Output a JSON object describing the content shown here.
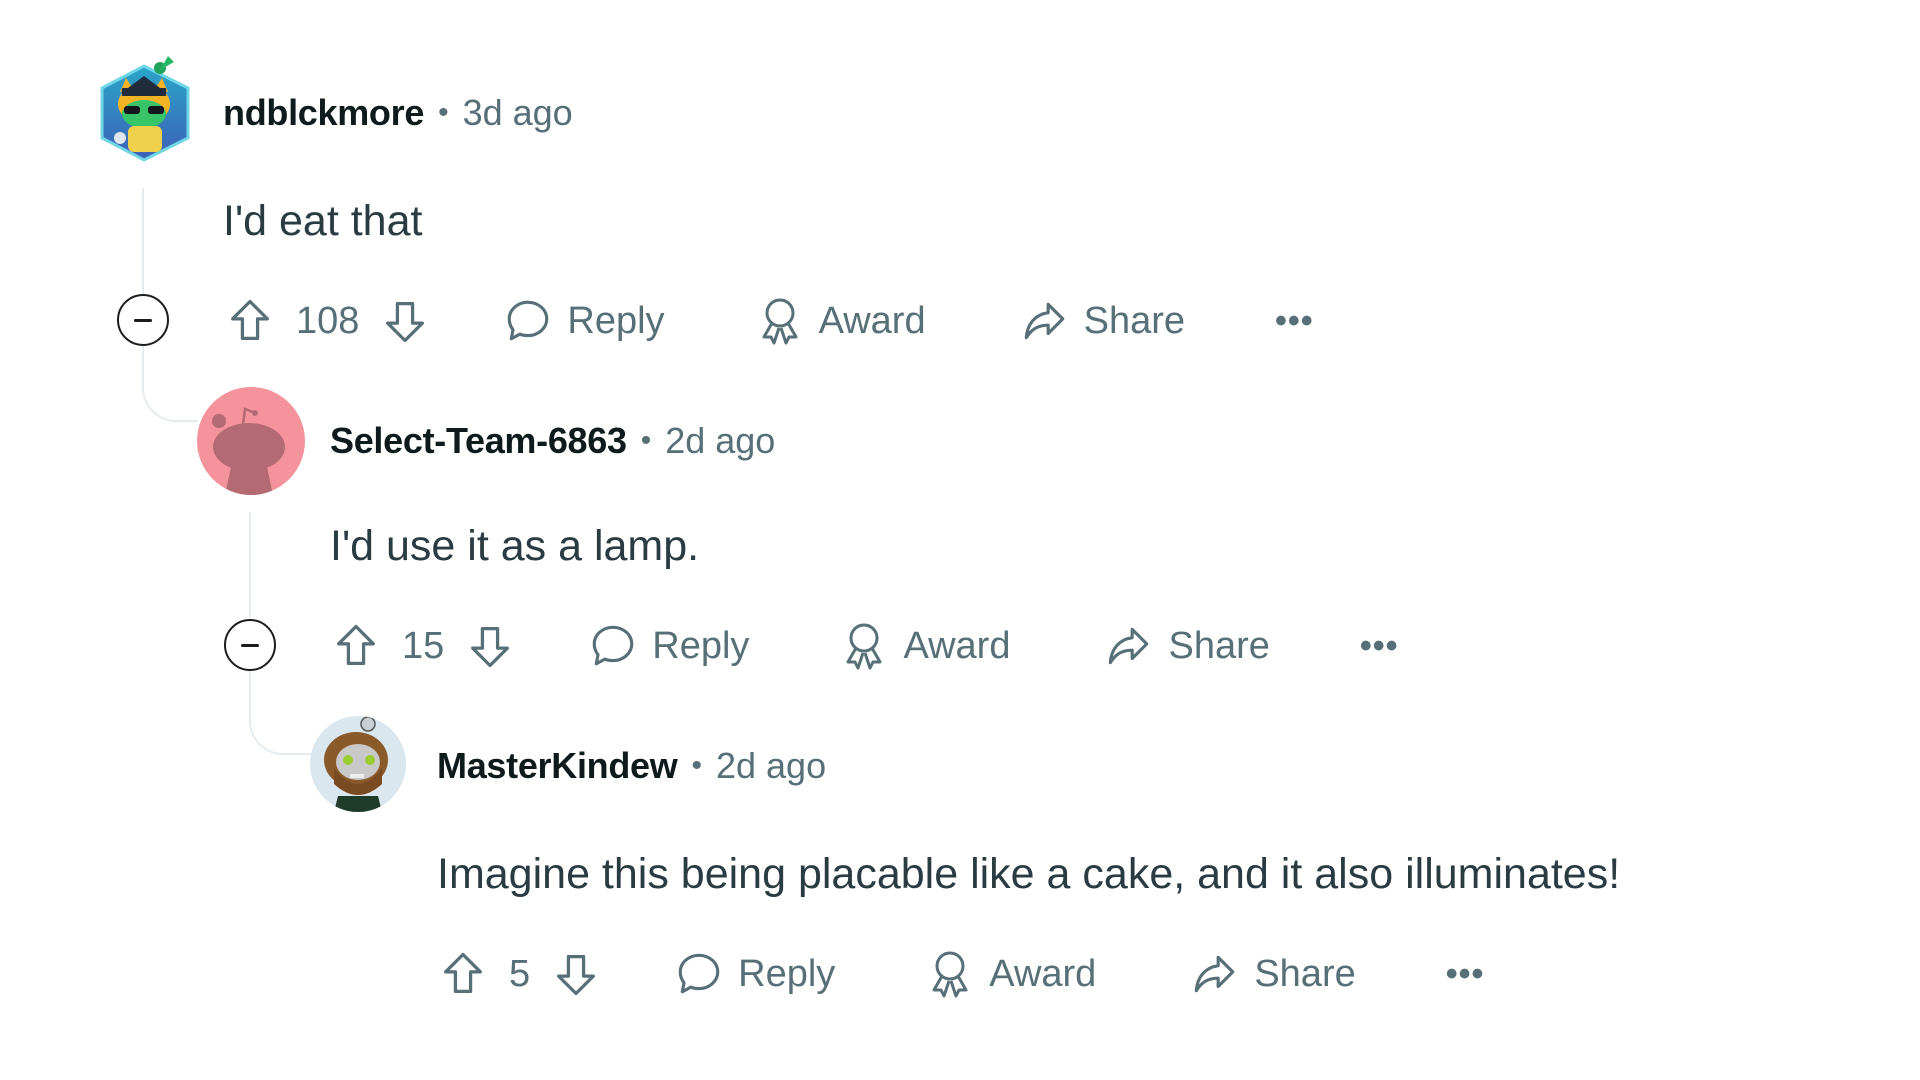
{
  "comments": [
    {
      "username": "ndblckmore",
      "separator": "•",
      "time": "3d ago",
      "body": "I'd eat that",
      "votes": "108",
      "avatar": "hexagon-snoo-avatar-graduation-cap",
      "actions": {
        "reply": "Reply",
        "award": "Award",
        "share": "Share",
        "more": "•••"
      }
    },
    {
      "username": "Select-Team-6863",
      "separator": "•",
      "time": "2d ago",
      "body": "I'd use it as a lamp.",
      "votes": "15",
      "avatar": "default-snoo-avatar-pink",
      "actions": {
        "reply": "Reply",
        "award": "Award",
        "share": "Share",
        "more": "•••"
      }
    },
    {
      "username": "MasterKindew",
      "separator": "•",
      "time": "2d ago",
      "body": "Imagine this being placable like a cake, and it also illuminates!",
      "votes": "5",
      "avatar": "bearded-snoo-avatar",
      "actions": {
        "reply": "Reply",
        "award": "Award",
        "share": "Share",
        "more": "•••"
      }
    }
  ],
  "colors": {
    "username": "#0f1a1c",
    "meta": "#576f76",
    "body": "#2a3c42",
    "thread_line": "#e5ebee",
    "default_avatar_bg": "#f4939b"
  }
}
